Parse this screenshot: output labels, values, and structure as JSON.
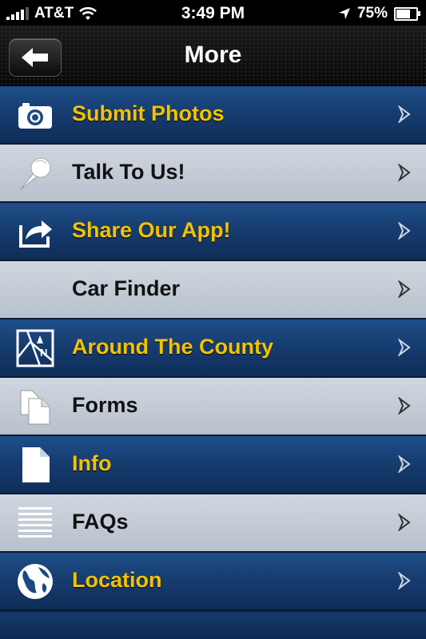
{
  "status_bar": {
    "carrier": "AT&T",
    "time": "3:49 PM",
    "battery": "75%",
    "battery_level": 0.75,
    "icons": [
      "signal-bars-icon",
      "wifi-icon",
      "location-arrow-icon",
      "battery-icon"
    ]
  },
  "navbar": {
    "title": "More",
    "back_icon": "back-arrow-icon"
  },
  "menu": {
    "items": [
      {
        "label": "Submit Photos",
        "icon": "camera-icon",
        "style": "dark"
      },
      {
        "label": "Talk To Us!",
        "icon": "microphone-icon",
        "style": "light"
      },
      {
        "label": "Share Our App!",
        "icon": "share-icon",
        "style": "dark"
      },
      {
        "label": "Car Finder",
        "icon": "",
        "style": "light"
      },
      {
        "label": "Around The County",
        "icon": "map-icon",
        "style": "dark"
      },
      {
        "label": "Forms",
        "icon": "documents-icon",
        "style": "light"
      },
      {
        "label": "Info",
        "icon": "document-icon",
        "style": "dark"
      },
      {
        "label": "FAQs",
        "icon": "list-lines-icon",
        "style": "light"
      },
      {
        "label": "Location",
        "icon": "globe-icon",
        "style": "dark"
      }
    ]
  },
  "colors": {
    "dark_row": "#1a457c",
    "light_row": "#c4ccd6",
    "accent_label": "#f5c200"
  }
}
